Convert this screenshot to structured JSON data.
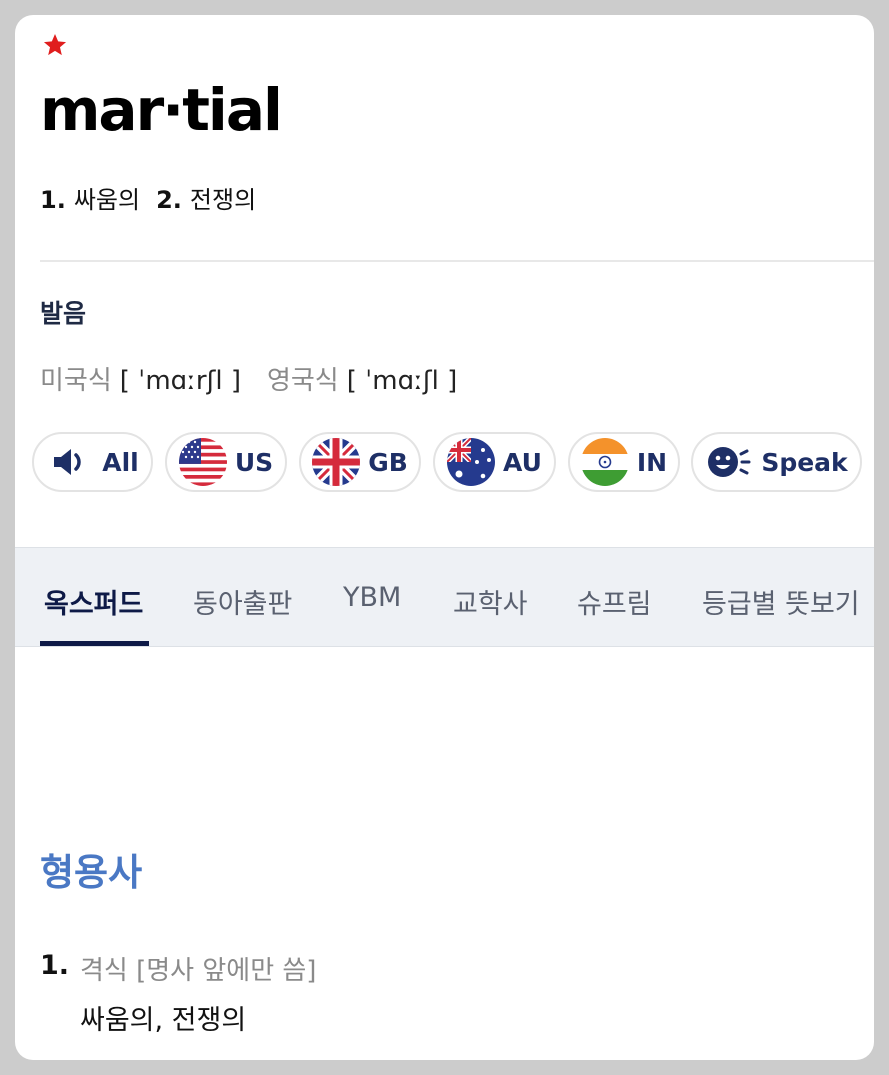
{
  "entry": {
    "word": "mar·tial",
    "summary": [
      {
        "num": "1.",
        "text": "싸움의"
      },
      {
        "num": "2.",
        "text": "전쟁의"
      }
    ]
  },
  "pronunciation": {
    "title": "발음",
    "us_label": "미국식",
    "us_ipa": "[ ˈmɑːrʃl ]",
    "uk_label": "영국식",
    "uk_ipa": "[ ˈmɑːʃl ]"
  },
  "audio_buttons": [
    {
      "label": "All",
      "icon": "speaker-icon"
    },
    {
      "label": "US",
      "icon": "us-flag-icon"
    },
    {
      "label": "GB",
      "icon": "gb-flag-icon"
    },
    {
      "label": "AU",
      "icon": "au-flag-icon"
    },
    {
      "label": "IN",
      "icon": "in-flag-icon"
    },
    {
      "label": "Speak",
      "icon": "speak-icon"
    }
  ],
  "tabs": [
    "옥스퍼드",
    "동아출판",
    "YBM",
    "교학사",
    "슈프림",
    "등급별 뜻보기"
  ],
  "active_tab": "옥스퍼드",
  "definition": {
    "part_of_speech": "형용사",
    "items": [
      {
        "num": "1.",
        "tag": "격식 [명사 앞에만 씀]",
        "text": "싸움의, 전쟁의"
      }
    ]
  },
  "colors": {
    "star": "#e01e1e",
    "button_text": "#1e2f66",
    "part_of_speech": "#4a78c4",
    "active_tab": "#0e1a47",
    "tab_bar": "#eef1f5"
  }
}
